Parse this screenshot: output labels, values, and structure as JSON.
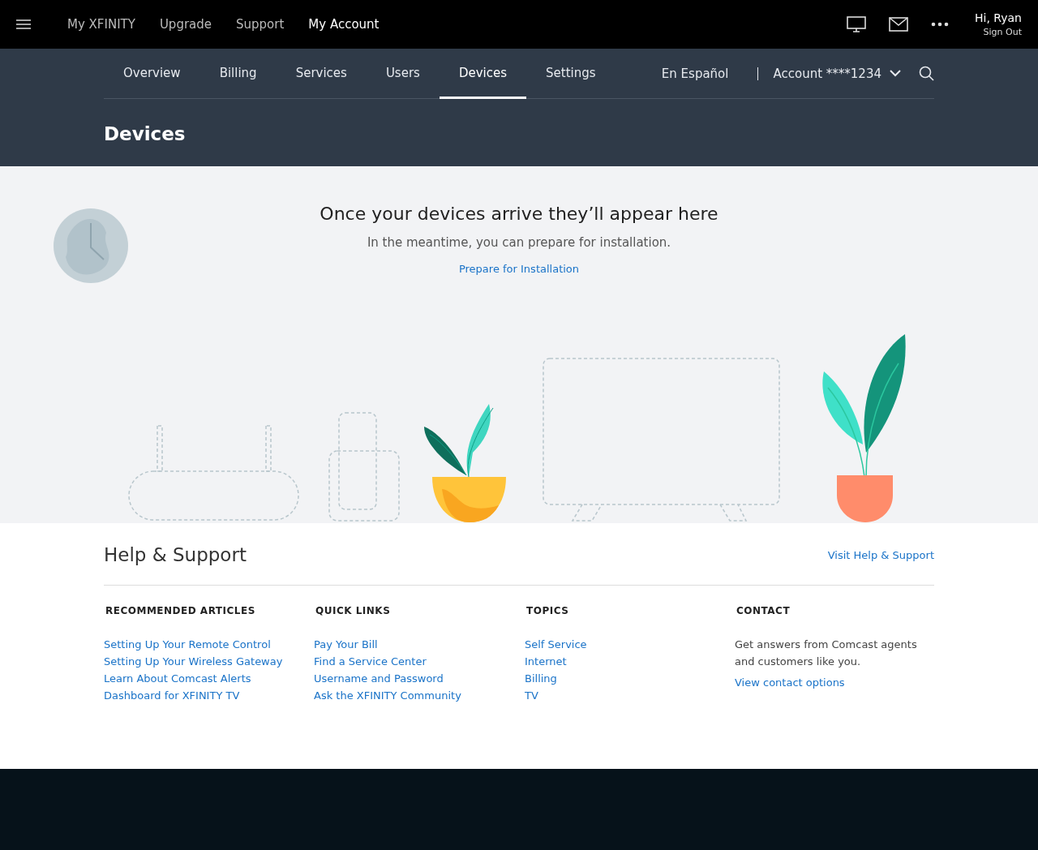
{
  "top_nav": {
    "items": [
      {
        "label": "My XFINITY",
        "selected": false
      },
      {
        "label": "Upgrade",
        "selected": false
      },
      {
        "label": "Support",
        "selected": false
      },
      {
        "label": "My Account",
        "selected": true
      }
    ],
    "greeting": "Hi, Ryan",
    "sign_out": "Sign Out"
  },
  "tabs": [
    {
      "label": "Overview",
      "selected": false
    },
    {
      "label": "Billing",
      "selected": false
    },
    {
      "label": "Services",
      "selected": false
    },
    {
      "label": "Users",
      "selected": false
    },
    {
      "label": "Devices",
      "selected": true
    },
    {
      "label": "Settings",
      "selected": false
    }
  ],
  "language_link": "En Español",
  "account": "Account ****1234",
  "page_title": "Devices",
  "empty_state": {
    "heading": "Once your devices arrive they’ll appear here",
    "text": "In the meantime, you can prepare for installation.",
    "link": "Prepare for Installation"
  },
  "help": {
    "title": "Help & Support",
    "visit_link": "Visit Help & Support",
    "columns": [
      {
        "heading": "RECOMMENDED ARTICLES",
        "links": [
          "Setting Up Your Remote Control",
          "Setting Up Your Wireless Gateway",
          "Learn About Comcast Alerts",
          "Dashboard for XFINITY TV"
        ]
      },
      {
        "heading": "QUICK LINKS",
        "links": [
          "Pay Your Bill",
          "Find a Service Center",
          "Username and Password",
          "Ask the XFINITY Community"
        ]
      },
      {
        "heading": "TOPICS",
        "links": [
          "Self Service",
          "Internet",
          "Billing",
          "TV"
        ]
      },
      {
        "heading": "CONTACT",
        "text": "Get answers from Comcast agents and customers like you.",
        "links": [
          "View contact options"
        ]
      }
    ]
  }
}
